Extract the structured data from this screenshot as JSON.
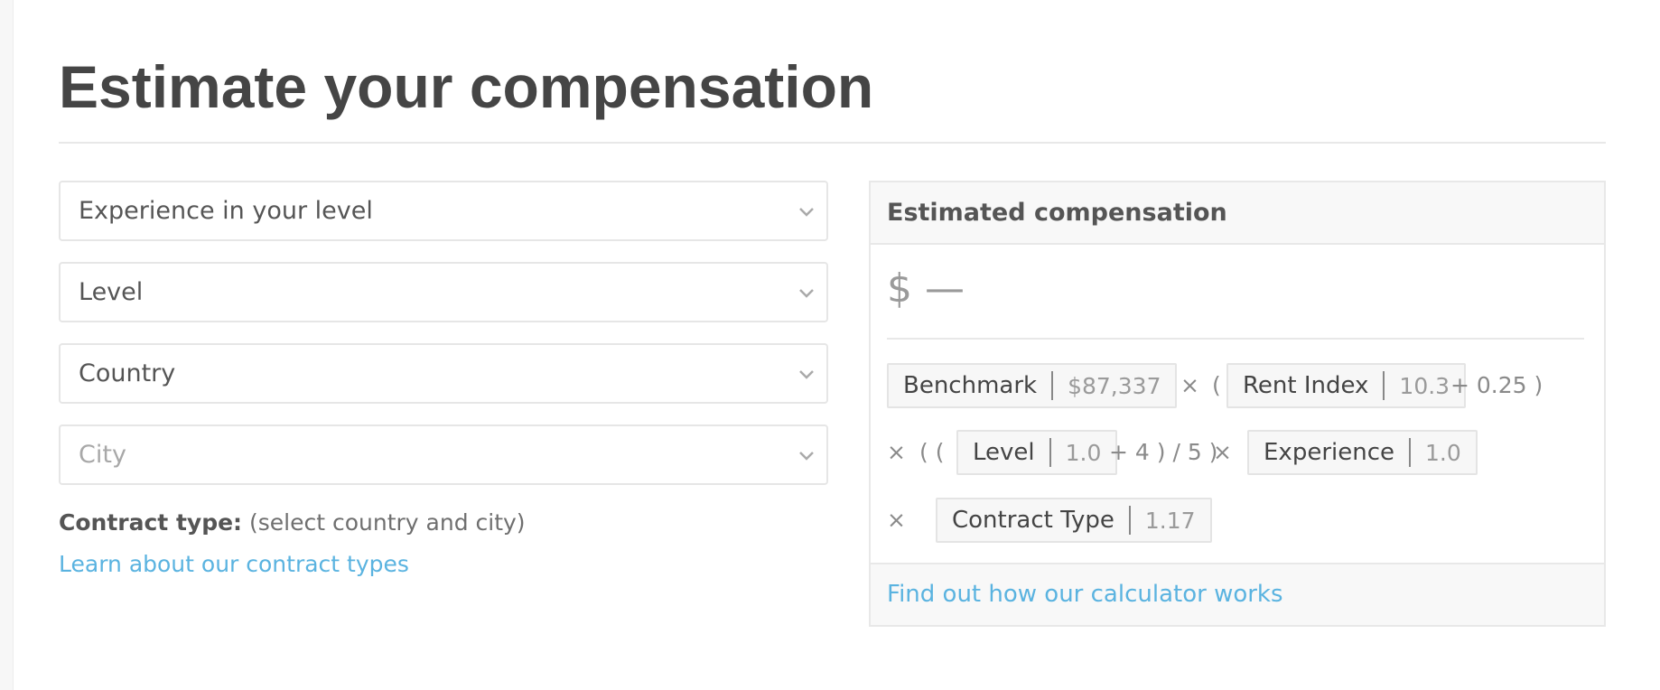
{
  "page": {
    "title": "Estimate your compensation"
  },
  "form": {
    "experience": {
      "value": "Experience in your level"
    },
    "level": {
      "value": "Level"
    },
    "country": {
      "value": "Country"
    },
    "city": {
      "placeholder": "City"
    },
    "contract_label": "Contract type:",
    "contract_value": "(select country and city)",
    "learn_link": "Learn about our contract types"
  },
  "panel": {
    "title": "Estimated compensation",
    "amount": "$ —",
    "formula": {
      "benchmark": {
        "label": "Benchmark",
        "value": "$87,337"
      },
      "op1": "×",
      "open1": "(",
      "rent_index": {
        "label": "Rent Index",
        "value": "10.3"
      },
      "rent_suffix": "+ 0.25 )",
      "op2": "×",
      "open2": "( (",
      "level": {
        "label": "Level",
        "value": "1.0"
      },
      "level_suffix": "+ 4 ) / 5 )",
      "op3": "×",
      "experience": {
        "label": "Experience",
        "value": "1.0"
      },
      "op4": "×",
      "contract_type": {
        "label": "Contract Type",
        "value": "1.17"
      }
    },
    "footer_link": "Find out how our calculator works"
  },
  "colors": {
    "link": "#5ab3e0",
    "text": "#444444",
    "muted": "#9a9a9a",
    "border": "#e6e6e6"
  }
}
